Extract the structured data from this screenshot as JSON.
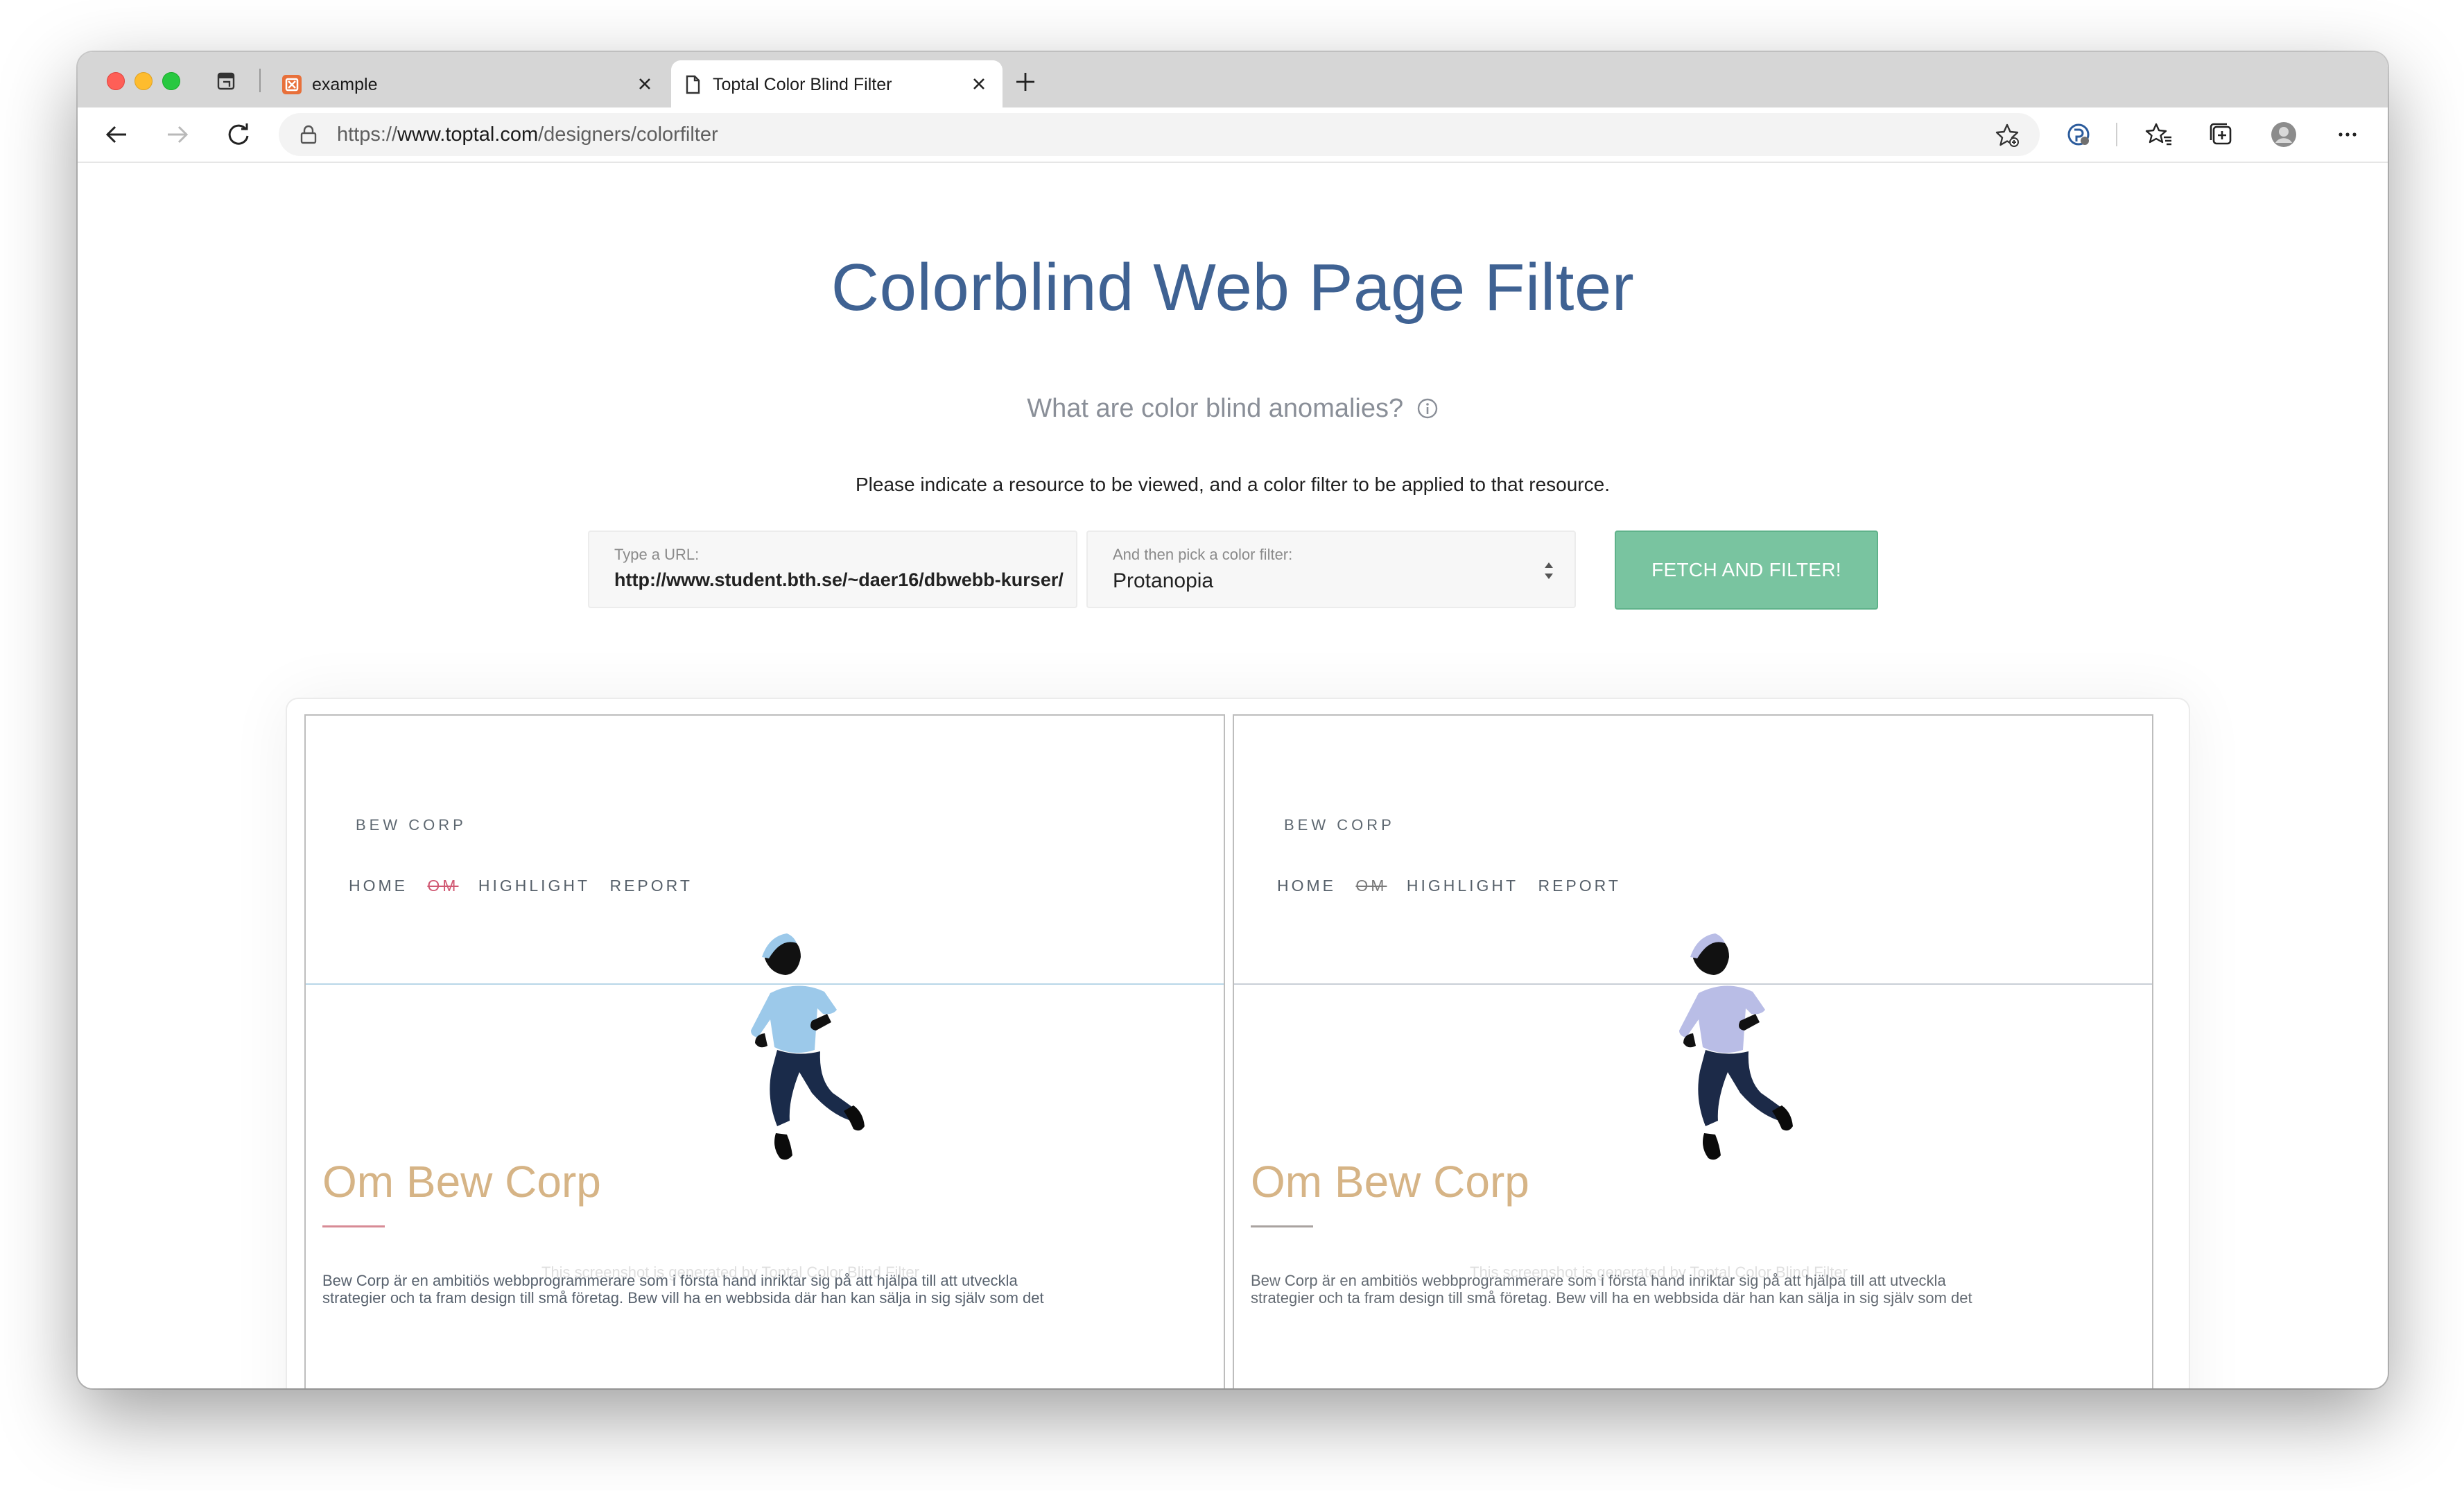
{
  "browser": {
    "tabs": [
      {
        "title": "example",
        "active": false,
        "favicon": "orange-app-icon"
      },
      {
        "title": "Toptal Color Blind Filter",
        "active": true,
        "favicon": "page-icon"
      }
    ],
    "address": {
      "prefix": "https://",
      "host": "www.toptal.com",
      "path": "/designers/colorfilter"
    },
    "icons": [
      "back-icon",
      "forward-icon",
      "reload-icon",
      "lock-icon",
      "add-favorite-icon",
      "extension-icon",
      "favorites-icon",
      "collections-icon",
      "profile-icon",
      "more-icon"
    ]
  },
  "page": {
    "title": "Colorblind Web Page Filter",
    "subtitle": "What are color blind anomalies?",
    "instructions": "Please indicate a resource to be viewed, and a color filter to be applied to that resource.",
    "url_field": {
      "label": "Type a URL:",
      "value": "http://www.student.bth.se/~daer16/dbwebb-kurser/"
    },
    "filter_field": {
      "label": "And then pick a color filter:",
      "value": "Protanopia"
    },
    "fetch_button": "FETCH AND FILTER!"
  },
  "previews": {
    "brand": "BEW CORP",
    "nav": [
      "HOME",
      "OM",
      "HIGHLIGHT",
      "REPORT"
    ],
    "heading": "Om Bew Corp",
    "watermark": "This screenshot is generated by Toptal Color Blind Filter",
    "paragraph_line1": "Bew Corp är en ambitiös webbprogrammerare som i första hand inriktar sig på att hjälpa till att utveckla",
    "paragraph_line2": "strategier och ta fram design till små företag. Bew vill ha en webbsida där han kan sälja in sig själv som det"
  },
  "colors": {
    "title": "#3f6293",
    "button": "#79c4a0",
    "heading": "#d6b486",
    "sweater_original": "#9cc9ea",
    "sweater_filtered": "#b9bde6"
  }
}
